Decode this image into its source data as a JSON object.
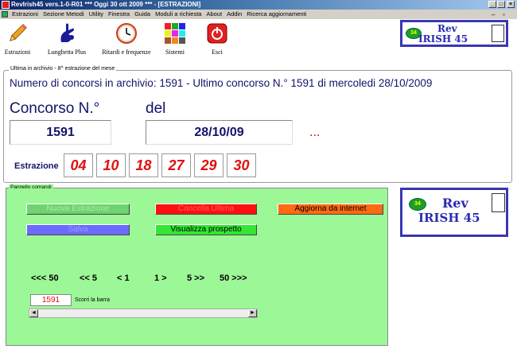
{
  "window": {
    "title": "RevIrish45 vers.1-0-R01   ***  Oggi 30 ott 2009   ***   - [ESTRAZIONI]"
  },
  "menu": [
    "Estrazioni",
    "Sezione Metodi",
    "Utility",
    "Finestra",
    "Guida",
    "Moduli a richiesta",
    "About",
    "Addin",
    "Ricerca aggiornamenti"
  ],
  "toolbar": {
    "estrazioni": "Estrazioni",
    "lunghetta": "Lunghetta Plus",
    "ritardi": "Ritardi e frequenze",
    "sistemi": "Sistemi",
    "esci": "Esci"
  },
  "logo": {
    "ball": "34",
    "line1": "Rev",
    "line2": "IRISH 45"
  },
  "archive": {
    "group_title": "Ultima in archivio - 8^ estrazione del mese",
    "info": "Numero di concorsi in archivio: 1591   -   Ultimo concorso N.° 1591 di mercoledi 28/10/2009",
    "concorso_label": "Concorso N.°",
    "del_label": "del",
    "concorso_value": "1591",
    "date_value": "28/10/09",
    "ellipsis": "...",
    "estrazione_label": "Estrazione",
    "numbers": [
      "04",
      "10",
      "18",
      "27",
      "29",
      "30"
    ]
  },
  "panel": {
    "title": "Pannello comandi",
    "nuova_estrazione": "Nuova Estrazione",
    "cancella_ultima": "Cancella Ultima",
    "aggiorna": "Aggiorna da internet",
    "salva": "Salva",
    "visualizza": "Visualizza prospetto",
    "nav": [
      "<<< 50",
      "<< 5",
      "< 1",
      "1 >",
      "5 >>",
      "50 >>>"
    ],
    "spin_value": "1591",
    "spin_label": "Scorri la barra"
  },
  "colors": {
    "panel_bg": "#9cf796",
    "btn_green": "#6fd36f",
    "btn_red": "#ff1010",
    "btn_orange": "#ff6a12",
    "btn_blue": "#6b6bff",
    "btn_bright_green": "#33e633",
    "number_red": "#e01010",
    "text_navy": "#13136a"
  }
}
